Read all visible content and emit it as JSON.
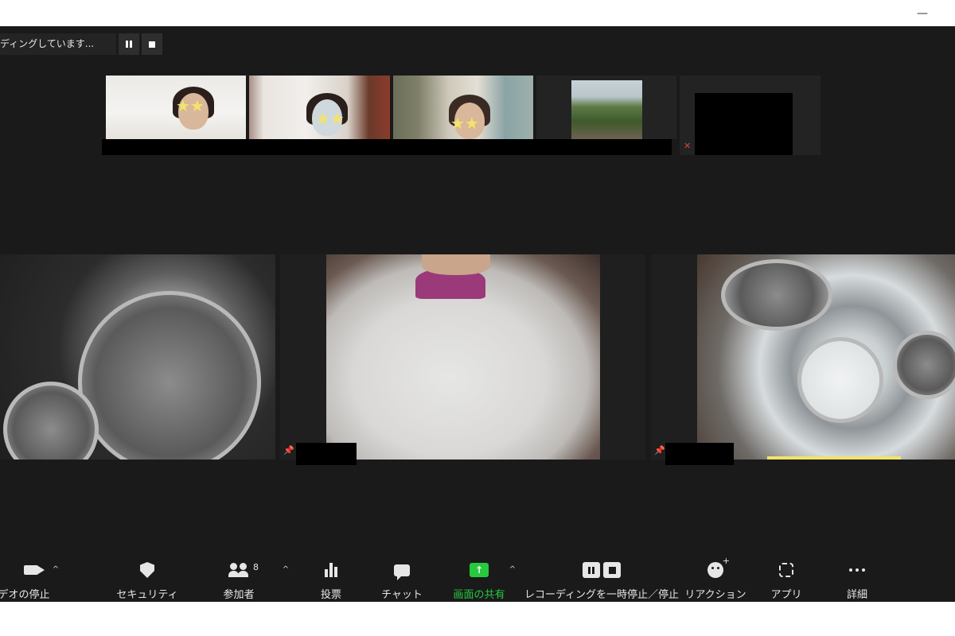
{
  "window": {
    "minimize_glyph": "—"
  },
  "recording": {
    "status_text": "ディングしています...",
    "pause_icon": "pause-icon",
    "stop_icon": "stop-icon"
  },
  "thumbnails": [
    {
      "id": "participant-1",
      "video": "on",
      "star_overlay": "★★"
    },
    {
      "id": "participant-2",
      "video": "on",
      "star_overlay": "★★"
    },
    {
      "id": "participant-3",
      "video": "on",
      "star_overlay": "★★"
    },
    {
      "id": "participant-4",
      "video": "on"
    },
    {
      "id": "participant-5",
      "video": "off",
      "muted_icon": "mic-muted-icon"
    }
  ],
  "gallery": {
    "pin_glyph": "📌"
  },
  "toolbar": {
    "video_label": "デオの停止",
    "security_label": "セキュリティ",
    "participants_label": "参加者",
    "participants_count": "8",
    "polls_label": "投票",
    "chat_label": "チャット",
    "share_label": "画面の共有",
    "share_arrow": "↑",
    "recording_label": "レコーディングを一時停止／停止",
    "reactions_label": "リアクション",
    "apps_label": "アプリ",
    "more_label": "詳細",
    "caret": "^"
  },
  "colors": {
    "stage_bg": "#1a1a1a",
    "share_accent": "#27c93f",
    "mute_red": "#e0403a",
    "highlight_yellow": "#f1e36b"
  }
}
